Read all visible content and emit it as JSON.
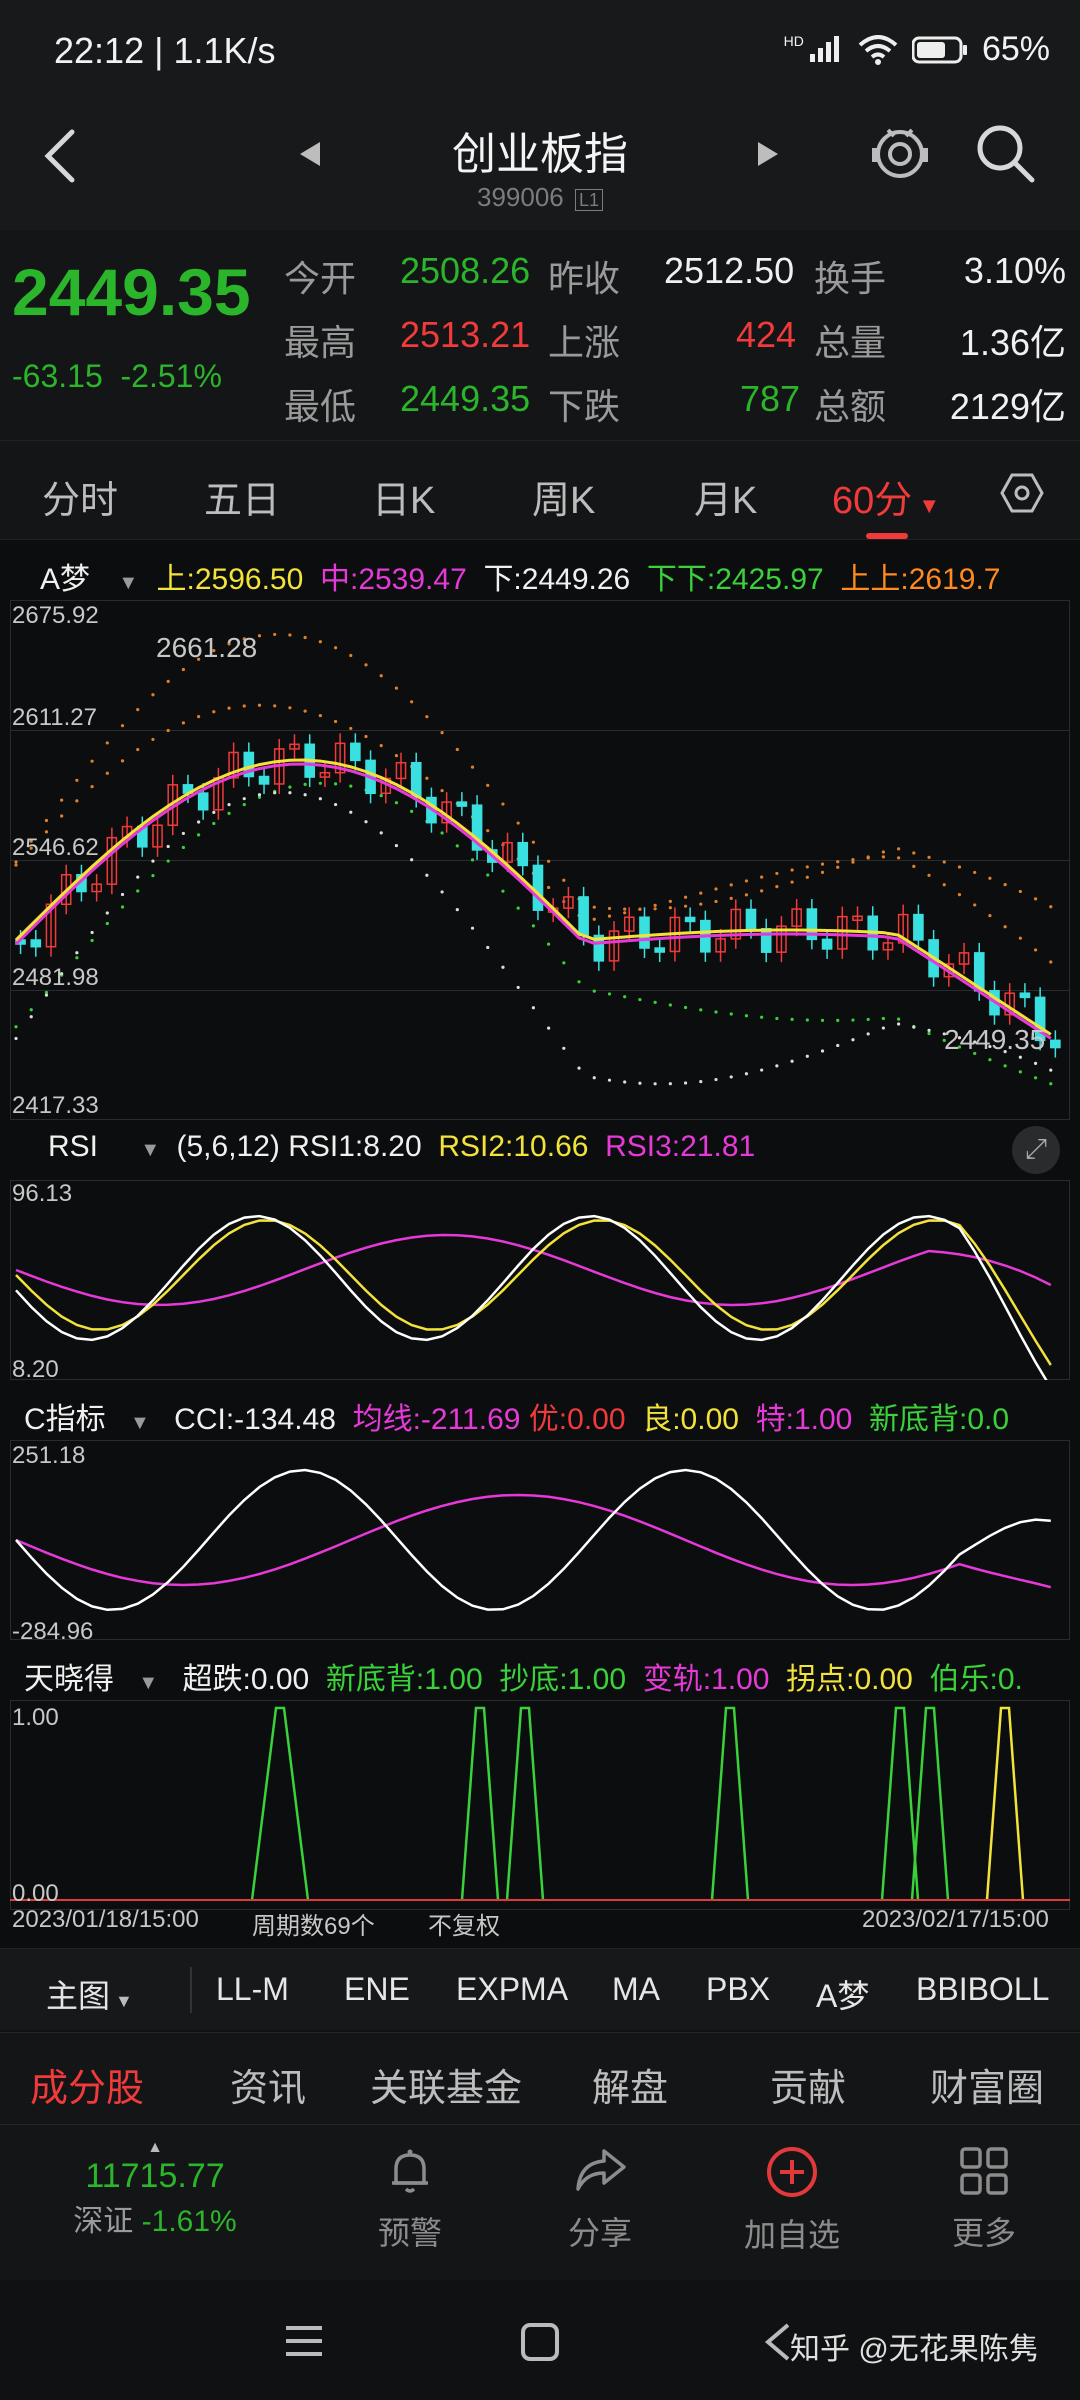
{
  "status": {
    "time": "22:12 | 1.1K/s",
    "battery": "65%",
    "hd": "HD"
  },
  "header": {
    "title": "创业板指",
    "code": "399006",
    "code_tag": "L1"
  },
  "quote": {
    "price": "2449.35",
    "change": "-63.15",
    "change_pct": "-2.51%",
    "rows": [
      {
        "l1": "今开",
        "v1": "2508.26",
        "l2": "昨收",
        "v2": "2512.50",
        "l3": "换手",
        "v3": "3.10%"
      },
      {
        "l1": "最高",
        "v1": "2513.21",
        "l2": "上涨",
        "v2": "424",
        "l3": "总量",
        "v3": "1.36亿"
      },
      {
        "l1": "最低",
        "v1": "2449.35",
        "l2": "下跌",
        "v2": "787",
        "l3": "总额",
        "v3": "2129亿"
      }
    ]
  },
  "tabs": [
    "分时",
    "五日",
    "日K",
    "周K",
    "月K",
    "60分"
  ],
  "active_tab": "60分",
  "main_chart": {
    "indicator": "A梦",
    "legend": {
      "up_label": "上:",
      "up": "2596.50",
      "mid_label": "中:",
      "mid": "2539.47",
      "low_label": "下:",
      "low": "2449.26",
      "lowlow_label": "下下:",
      "lowlow": "2425.97",
      "upup_label": "上上:",
      "upup": "2619.7"
    },
    "y_labels": [
      "2675.92",
      "2611.27",
      "2546.62",
      "2481.98",
      "2417.33"
    ],
    "high_mark": "2661.28",
    "low_mark": "2449.35"
  },
  "rsi": {
    "name": "RSI",
    "params": "(5,6,12)",
    "rsi1_label": "RSI1:",
    "rsi1": "8.20",
    "rsi2_label": "RSI2:",
    "rsi2": "10.66",
    "rsi3_label": "RSI3:",
    "rsi3": "21.81",
    "top": "96.13",
    "bottom": "8.20"
  },
  "cci": {
    "name": "C指标",
    "cci_label": "CCI:",
    "cci": "-134.48",
    "avg_label": "均线:",
    "avg": "-211.69",
    "you_label": "优:",
    "you": "0.00",
    "liang_label": "良:",
    "liang": "0.00",
    "te_label": "特:",
    "te": "1.00",
    "xdb_label": "新底背:",
    "xdb": "0.0",
    "top": "251.18",
    "bottom": "-284.96"
  },
  "txd": {
    "name": "天晓得",
    "cd_label": "超跌:",
    "cd": "0.00",
    "xdb_label": "新底背:",
    "xdb": "1.00",
    "chd_label": "抄底:",
    "chd": "1.00",
    "bg_label": "变轨:",
    "bg": "1.00",
    "gd_label": "拐点:",
    "gd": "0.00",
    "bl_label": "伯乐:",
    "bl": "0.",
    "top": "1.00",
    "bottom": "0.00"
  },
  "footer_axis": {
    "start": "2023/01/18/15:00",
    "period": "周期数69个",
    "adj": "不复权",
    "end": "2023/02/17/15:00"
  },
  "indicators": {
    "main_label": "主图",
    "items": [
      "LL-M",
      "ENE",
      "EXPMA",
      "MA",
      "PBX",
      "A梦",
      "BBIBOLL"
    ],
    "active": "A梦"
  },
  "bottom_tabs": [
    "成分股",
    "资讯",
    "关联基金",
    "解盘",
    "贡献",
    "财富圈"
  ],
  "bottom_active": "成分股",
  "actions": {
    "index_value": "11715.77",
    "index_name": "深证",
    "index_change": "-1.61%",
    "alert": "预警",
    "share": "分享",
    "add": "加自选",
    "more": "更多"
  },
  "watermark": "知乎 @无花果陈隽"
}
